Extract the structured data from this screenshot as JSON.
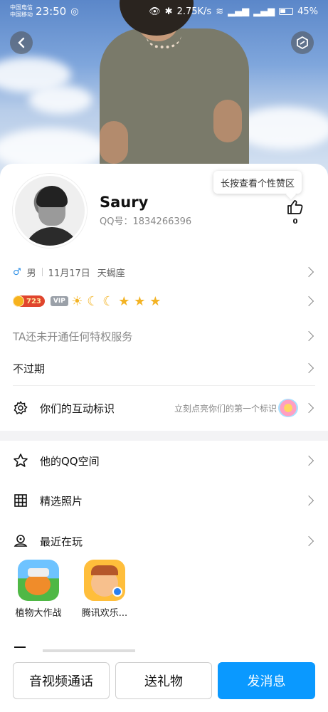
{
  "status_bar": {
    "carrier_1": "中国电信",
    "carrier_2": "中国移动",
    "time": "23:50",
    "speed": "2.75K/s",
    "battery": "45%"
  },
  "profile": {
    "name": "Saury",
    "qq_label": "QQ号：1834266396",
    "tooltip": "长按查看个性赞区",
    "like_count": "0"
  },
  "info": {
    "gender_icon": "♂",
    "gender": "男",
    "birthday": "11月17日",
    "zodiac": "天蝎座",
    "coin_level": "723",
    "vip_label": "VIP",
    "privilege_text": "TA还未开通任何特权服务",
    "not_expired": "不过期"
  },
  "interaction": {
    "label": "你们的互动标识",
    "hint": "立刻点亮你们的第一个标识"
  },
  "menu": {
    "qzone": "他的QQ空间",
    "photos": "精选照片",
    "recent_play": "最近在玩"
  },
  "games": [
    {
      "label": "植物大作战"
    },
    {
      "label": "腾讯欢乐..."
    }
  ],
  "actions": {
    "call": "音视频通话",
    "gift": "送礼物",
    "message": "发消息"
  },
  "colors": {
    "primary": "#0a99ff",
    "gender": "#2b8ee6"
  }
}
